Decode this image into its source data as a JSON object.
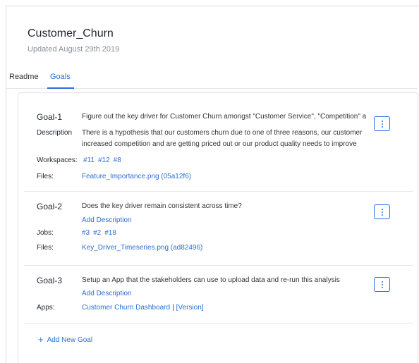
{
  "project": {
    "title": "Customer_Churn",
    "updated": "Updated August 29th 2019"
  },
  "tabs": [
    {
      "label": "Readme",
      "active": false
    },
    {
      "label": "Goals",
      "active": true
    }
  ],
  "goals": [
    {
      "key": "Goal-1",
      "title": "Figure out the key driver for Customer Churn amongst \"Customer Service\", \"Competition\" a",
      "description_label": "Description",
      "description_lines": [
        "There is a hypothesis that our customers churn due to one of three reasons, our customer",
        "increased competition and are getting priced out or our product quality needs to improve"
      ],
      "workspaces_label": "Workspaces:",
      "workspaces": [
        "#11",
        "#12",
        "#8"
      ],
      "files_label": "Files:",
      "file": "Feature_Importance.png (05a12f6)"
    },
    {
      "key": "Goal-2",
      "title": "Does the key driver remain consistent across time?",
      "add_description": "Add Description",
      "jobs_label": "Jobs:",
      "jobs": [
        "#3",
        "#2",
        "#18"
      ],
      "files_label": "Files:",
      "file": "Key_Driver_Timeseries.png (ad82496)"
    },
    {
      "key": "Goal-3",
      "title": "Setup an App that the stakeholders can use to upload data and re-run this analysis",
      "add_description": "Add Description",
      "apps_label": "Apps:",
      "app": "Customer Churn Dashboard",
      "separator": "|",
      "version": "[Version]"
    }
  ],
  "add_goal": {
    "plus": "+",
    "label": "Add New Goal"
  },
  "colors": {
    "accent": "#2a6fdb",
    "text": "#1f2430",
    "muted": "#8a8f98",
    "border": "#e2e4e8"
  }
}
